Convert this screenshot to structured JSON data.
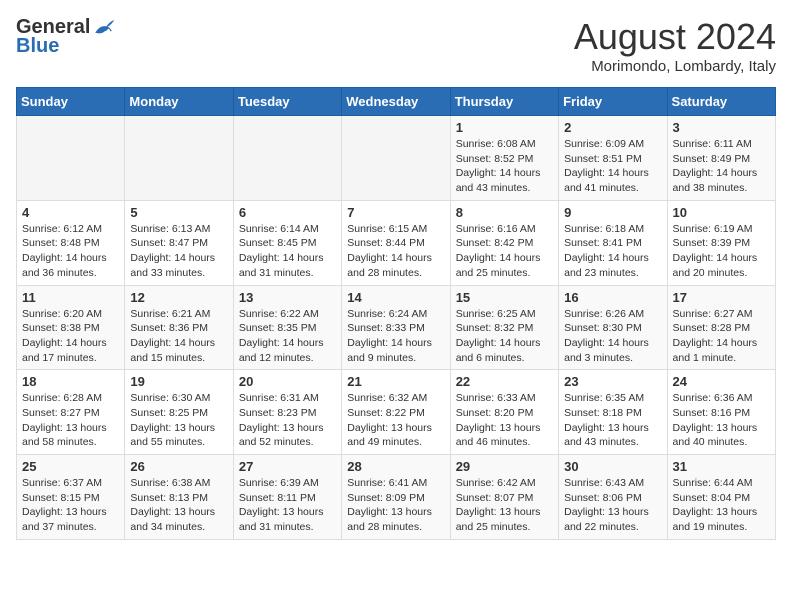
{
  "header": {
    "logo_general": "General",
    "logo_blue": "Blue",
    "month": "August 2024",
    "location": "Morimondo, Lombardy, Italy"
  },
  "days_of_week": [
    "Sunday",
    "Monday",
    "Tuesday",
    "Wednesday",
    "Thursday",
    "Friday",
    "Saturday"
  ],
  "weeks": [
    [
      {
        "day": "",
        "info": ""
      },
      {
        "day": "",
        "info": ""
      },
      {
        "day": "",
        "info": ""
      },
      {
        "day": "",
        "info": ""
      },
      {
        "day": "1",
        "info": "Sunrise: 6:08 AM\nSunset: 8:52 PM\nDaylight: 14 hours and 43 minutes."
      },
      {
        "day": "2",
        "info": "Sunrise: 6:09 AM\nSunset: 8:51 PM\nDaylight: 14 hours and 41 minutes."
      },
      {
        "day": "3",
        "info": "Sunrise: 6:11 AM\nSunset: 8:49 PM\nDaylight: 14 hours and 38 minutes."
      }
    ],
    [
      {
        "day": "4",
        "info": "Sunrise: 6:12 AM\nSunset: 8:48 PM\nDaylight: 14 hours and 36 minutes."
      },
      {
        "day": "5",
        "info": "Sunrise: 6:13 AM\nSunset: 8:47 PM\nDaylight: 14 hours and 33 minutes."
      },
      {
        "day": "6",
        "info": "Sunrise: 6:14 AM\nSunset: 8:45 PM\nDaylight: 14 hours and 31 minutes."
      },
      {
        "day": "7",
        "info": "Sunrise: 6:15 AM\nSunset: 8:44 PM\nDaylight: 14 hours and 28 minutes."
      },
      {
        "day": "8",
        "info": "Sunrise: 6:16 AM\nSunset: 8:42 PM\nDaylight: 14 hours and 25 minutes."
      },
      {
        "day": "9",
        "info": "Sunrise: 6:18 AM\nSunset: 8:41 PM\nDaylight: 14 hours and 23 minutes."
      },
      {
        "day": "10",
        "info": "Sunrise: 6:19 AM\nSunset: 8:39 PM\nDaylight: 14 hours and 20 minutes."
      }
    ],
    [
      {
        "day": "11",
        "info": "Sunrise: 6:20 AM\nSunset: 8:38 PM\nDaylight: 14 hours and 17 minutes."
      },
      {
        "day": "12",
        "info": "Sunrise: 6:21 AM\nSunset: 8:36 PM\nDaylight: 14 hours and 15 minutes."
      },
      {
        "day": "13",
        "info": "Sunrise: 6:22 AM\nSunset: 8:35 PM\nDaylight: 14 hours and 12 minutes."
      },
      {
        "day": "14",
        "info": "Sunrise: 6:24 AM\nSunset: 8:33 PM\nDaylight: 14 hours and 9 minutes."
      },
      {
        "day": "15",
        "info": "Sunrise: 6:25 AM\nSunset: 8:32 PM\nDaylight: 14 hours and 6 minutes."
      },
      {
        "day": "16",
        "info": "Sunrise: 6:26 AM\nSunset: 8:30 PM\nDaylight: 14 hours and 3 minutes."
      },
      {
        "day": "17",
        "info": "Sunrise: 6:27 AM\nSunset: 8:28 PM\nDaylight: 14 hours and 1 minute."
      }
    ],
    [
      {
        "day": "18",
        "info": "Sunrise: 6:28 AM\nSunset: 8:27 PM\nDaylight: 13 hours and 58 minutes."
      },
      {
        "day": "19",
        "info": "Sunrise: 6:30 AM\nSunset: 8:25 PM\nDaylight: 13 hours and 55 minutes."
      },
      {
        "day": "20",
        "info": "Sunrise: 6:31 AM\nSunset: 8:23 PM\nDaylight: 13 hours and 52 minutes."
      },
      {
        "day": "21",
        "info": "Sunrise: 6:32 AM\nSunset: 8:22 PM\nDaylight: 13 hours and 49 minutes."
      },
      {
        "day": "22",
        "info": "Sunrise: 6:33 AM\nSunset: 8:20 PM\nDaylight: 13 hours and 46 minutes."
      },
      {
        "day": "23",
        "info": "Sunrise: 6:35 AM\nSunset: 8:18 PM\nDaylight: 13 hours and 43 minutes."
      },
      {
        "day": "24",
        "info": "Sunrise: 6:36 AM\nSunset: 8:16 PM\nDaylight: 13 hours and 40 minutes."
      }
    ],
    [
      {
        "day": "25",
        "info": "Sunrise: 6:37 AM\nSunset: 8:15 PM\nDaylight: 13 hours and 37 minutes."
      },
      {
        "day": "26",
        "info": "Sunrise: 6:38 AM\nSunset: 8:13 PM\nDaylight: 13 hours and 34 minutes."
      },
      {
        "day": "27",
        "info": "Sunrise: 6:39 AM\nSunset: 8:11 PM\nDaylight: 13 hours and 31 minutes."
      },
      {
        "day": "28",
        "info": "Sunrise: 6:41 AM\nSunset: 8:09 PM\nDaylight: 13 hours and 28 minutes."
      },
      {
        "day": "29",
        "info": "Sunrise: 6:42 AM\nSunset: 8:07 PM\nDaylight: 13 hours and 25 minutes."
      },
      {
        "day": "30",
        "info": "Sunrise: 6:43 AM\nSunset: 8:06 PM\nDaylight: 13 hours and 22 minutes."
      },
      {
        "day": "31",
        "info": "Sunrise: 6:44 AM\nSunset: 8:04 PM\nDaylight: 13 hours and 19 minutes."
      }
    ]
  ]
}
